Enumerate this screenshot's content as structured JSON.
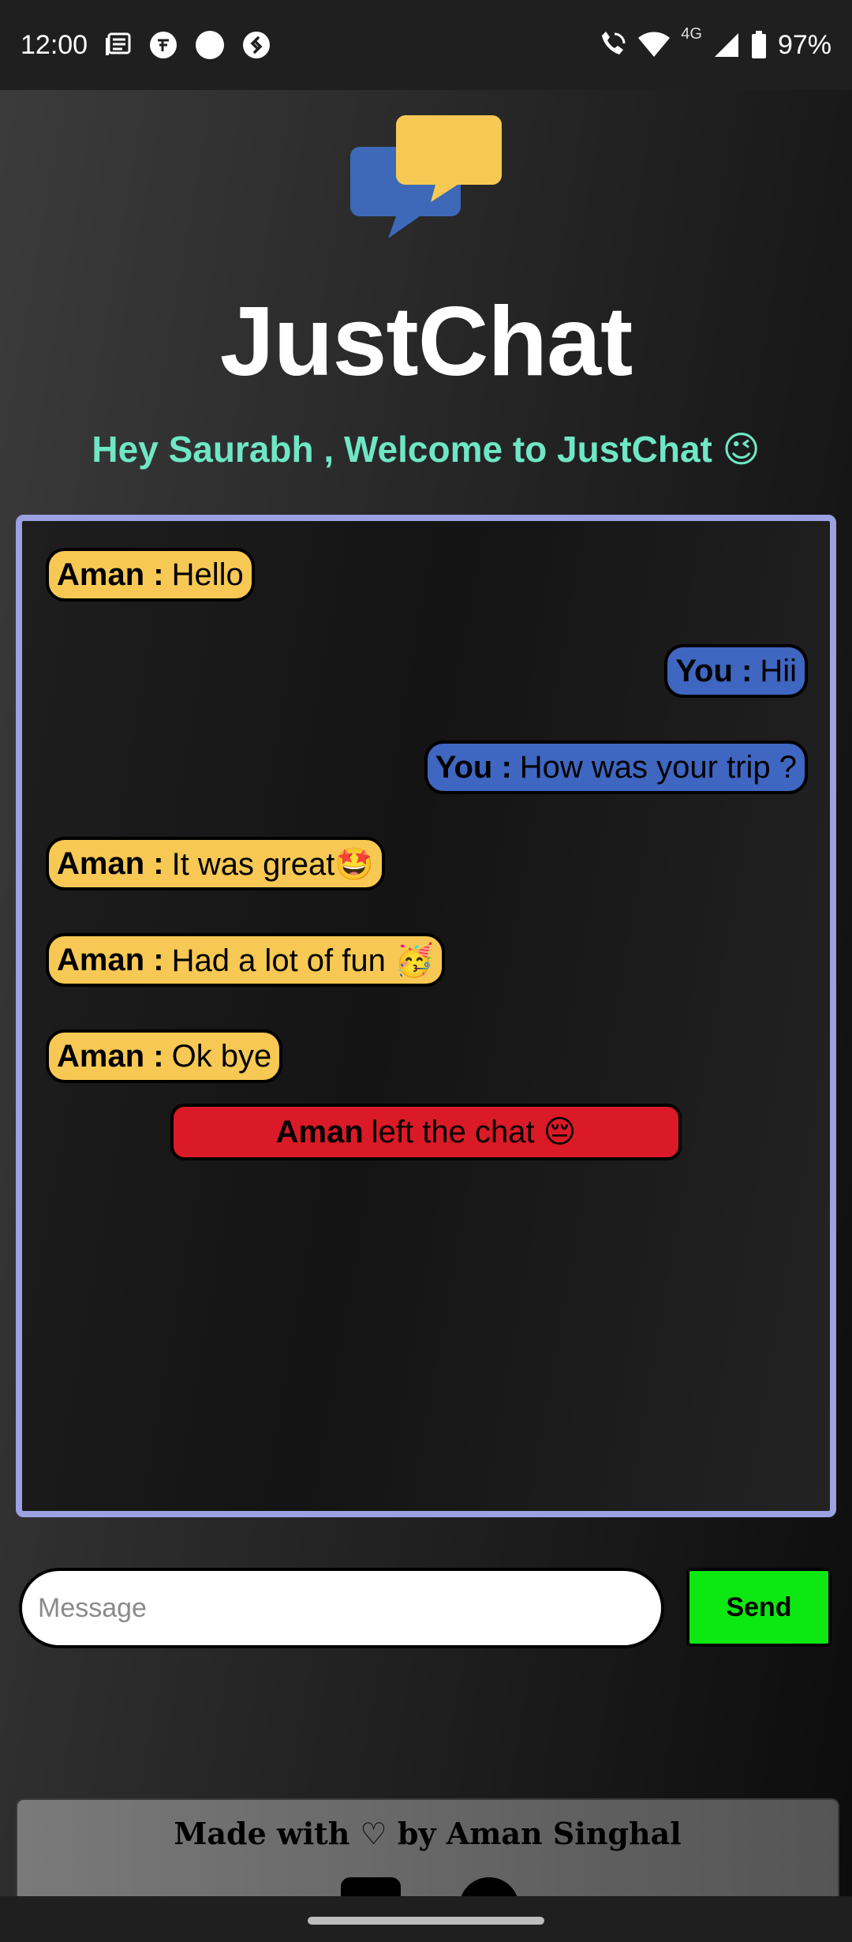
{
  "status_bar": {
    "time": "12:00",
    "network": "4G",
    "battery": "97%",
    "left_icons": [
      "news-icon",
      "payment-icon",
      "dot-icon",
      "shazam-icon"
    ],
    "right_icons": [
      "wifi-call-icon",
      "wifi-icon",
      "signal-icon",
      "battery-icon"
    ]
  },
  "header": {
    "app_name": "JustChat",
    "welcome_text": "Hey Saurabh , Welcome to JustChat 😉"
  },
  "chat": {
    "border_color": "#9ba1e2",
    "messages": [
      {
        "sender": "Aman :",
        "text": "Hello",
        "direction": "incoming"
      },
      {
        "sender": "You :",
        "text": "Hii",
        "direction": "outgoing"
      },
      {
        "sender": "You :",
        "text": "How was your trip ?",
        "direction": "outgoing"
      },
      {
        "sender": "Aman :",
        "text": "It was great🤩",
        "direction": "incoming"
      },
      {
        "sender": "Aman :",
        "text": "Had a lot of fun 🥳",
        "direction": "incoming"
      },
      {
        "sender": "Aman :",
        "text": "Ok bye",
        "direction": "incoming"
      }
    ],
    "notice": {
      "name": "Aman",
      "text": "left the chat 😔"
    }
  },
  "composer": {
    "placeholder": "Message",
    "value": "",
    "send_label": "Send"
  },
  "footer": {
    "text": "Made with ♡ by Aman Singhal",
    "icons": [
      "linkedin-icon",
      "github-icon"
    ]
  },
  "colors": {
    "incoming_bubble": "#f7c954",
    "outgoing_bubble": "#3f66c0",
    "notice": "#da1a26",
    "send_button": "#0de712",
    "welcome_text": "#6fe7c4"
  }
}
